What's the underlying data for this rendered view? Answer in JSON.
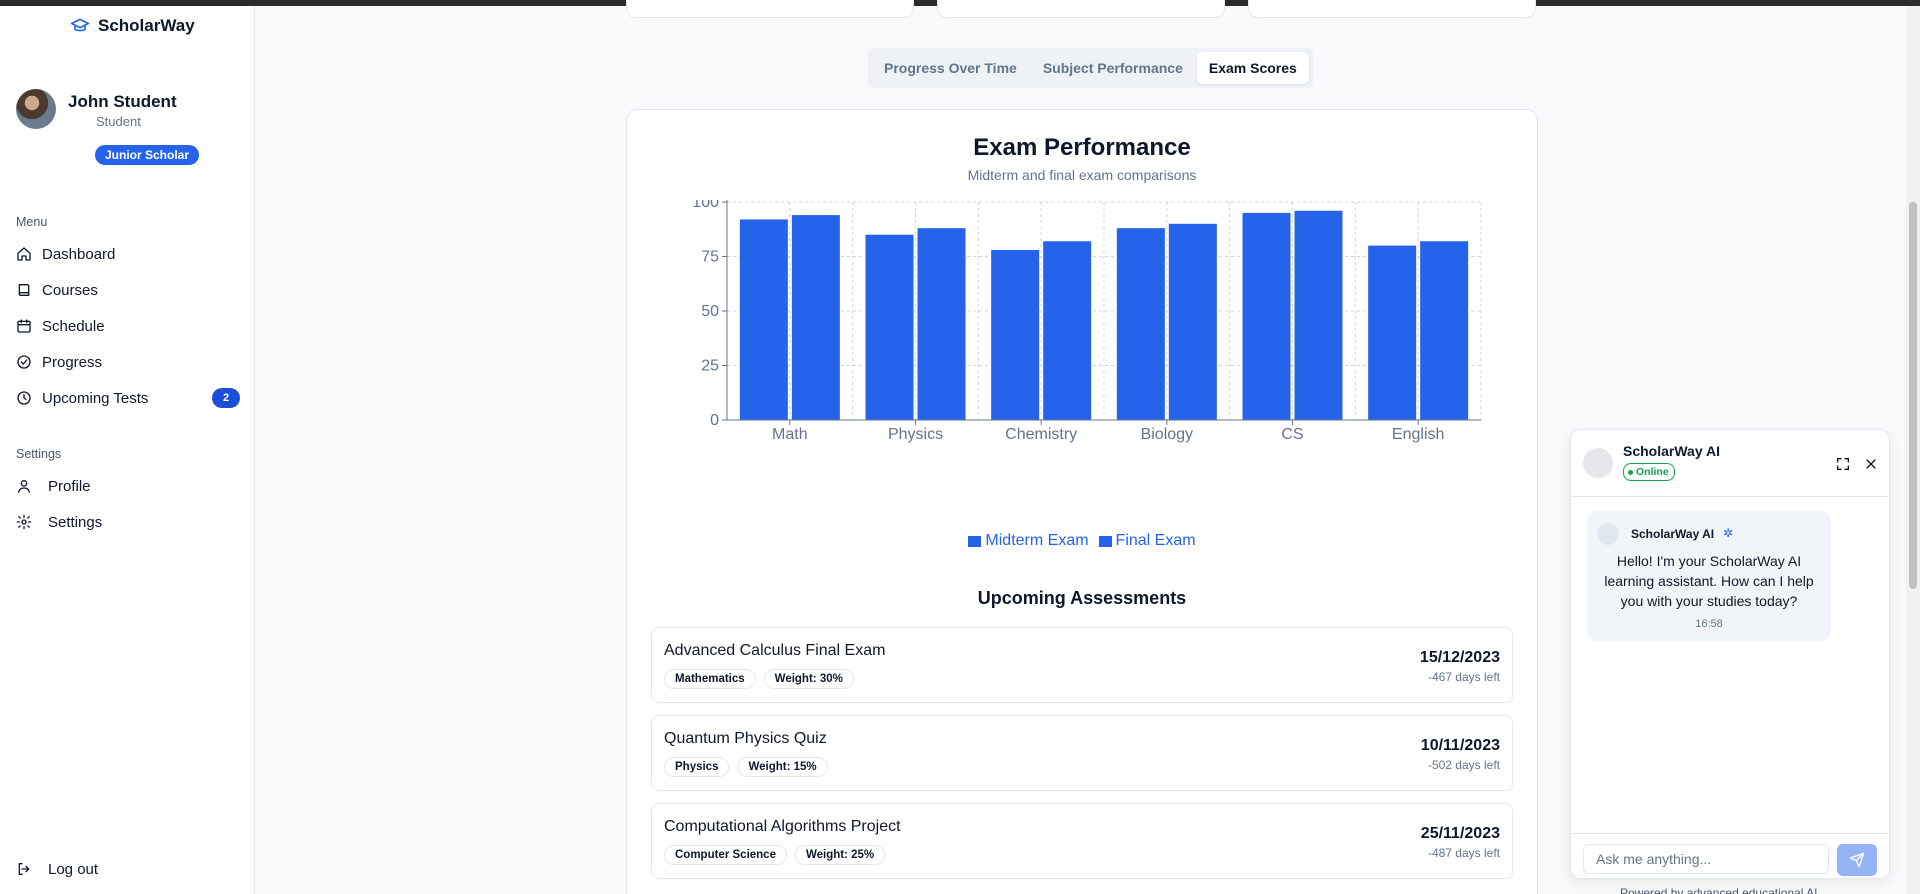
{
  "app": {
    "brand": "ScholarWay"
  },
  "user": {
    "name": "John Student",
    "role": "Student",
    "level": "Junior Scholar"
  },
  "sidebar": {
    "menu_label": "Menu",
    "items": [
      {
        "label": "Dashboard",
        "icon": "home-icon"
      },
      {
        "label": "Courses",
        "icon": "book-icon"
      },
      {
        "label": "Schedule",
        "icon": "calendar-icon"
      },
      {
        "label": "Progress",
        "icon": "check-circle-icon"
      },
      {
        "label": "Upcoming Tests",
        "icon": "clock-icon",
        "count": "2"
      }
    ],
    "settings_label": "Settings",
    "settings_items": [
      {
        "label": "Profile",
        "icon": "user-icon"
      },
      {
        "label": "Settings",
        "icon": "gear-icon"
      }
    ],
    "logout": "Log out"
  },
  "tabs": [
    {
      "label": "Progress Over Time",
      "active": false
    },
    {
      "label": "Subject Performance",
      "active": false
    },
    {
      "label": "Exam Scores",
      "active": true
    }
  ],
  "chart_data": {
    "type": "bar",
    "title": "Exam Performance",
    "subtitle": "Midterm and final exam comparisons",
    "categories": [
      "Math",
      "Physics",
      "Chemistry",
      "Biology",
      "CS",
      "English"
    ],
    "series": [
      {
        "name": "Midterm Exam",
        "values": [
          92,
          85,
          78,
          88,
          95,
          80
        ]
      },
      {
        "name": "Final Exam",
        "values": [
          94,
          88,
          82,
          90,
          96,
          82
        ]
      }
    ],
    "ylim": [
      0,
      100
    ],
    "yticks": [
      0,
      25,
      50,
      75,
      100
    ],
    "grid": true,
    "legend": "bottom",
    "color": "#2563eb"
  },
  "assessments": {
    "title": "Upcoming Assessments",
    "items": [
      {
        "name": "Advanced Calculus Final Exam",
        "subject": "Mathematics",
        "weight": "Weight: 30%",
        "date": "15/12/2023",
        "days_left": "-467 days left"
      },
      {
        "name": "Quantum Physics Quiz",
        "subject": "Physics",
        "weight": "Weight: 15%",
        "date": "10/11/2023",
        "days_left": "-502 days left"
      },
      {
        "name": "Computational Algorithms Project",
        "subject": "Computer Science",
        "weight": "Weight: 25%",
        "date": "25/11/2023",
        "days_left": "-487 days left"
      }
    ]
  },
  "chat": {
    "title": "ScholarWay AI",
    "status": "Online",
    "message_sender": "ScholarWay AI",
    "message": "Hello! I'm your ScholarWay AI learning assistant. How can I help you with your studies today?",
    "time": "16:58",
    "placeholder": "Ask me anything...",
    "footer": "Powered by advanced educational AI"
  }
}
